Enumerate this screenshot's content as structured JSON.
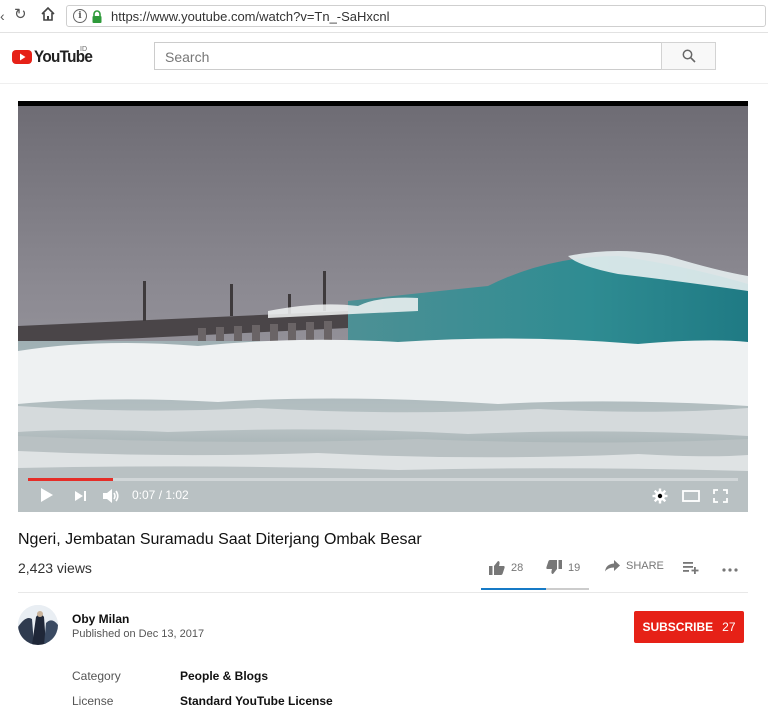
{
  "browser": {
    "url": "https://www.youtube.com/watch?v=Tn_-SaHxcnl"
  },
  "masthead": {
    "logo_text": "YouTube",
    "country_code": "ID",
    "search_placeholder": "Search"
  },
  "player": {
    "time_display": "0:07 / 1:02",
    "progress_fraction": 0.12
  },
  "video": {
    "title": "Ngeri, Jembatan Suramadu Saat Diterjang Ombak Besar",
    "views": "2,423 views",
    "likes": "28",
    "dislikes": "19",
    "share_label": "SHARE",
    "like_ratio": 0.6
  },
  "channel": {
    "name": "Oby Milan",
    "published": "Published on Dec 13, 2017",
    "subscribe_label": "SUBSCRIBE",
    "subscriber_count": "27"
  },
  "metadata": [
    {
      "label": "Category",
      "value": "People & Blogs"
    },
    {
      "label": "License",
      "value": "Standard YouTube License"
    }
  ],
  "colors": {
    "subscribe_red": "#e62117",
    "progress_red": "#e52d27",
    "like_blue": "#167ac6",
    "ocean_teal": "#2f8c92"
  }
}
